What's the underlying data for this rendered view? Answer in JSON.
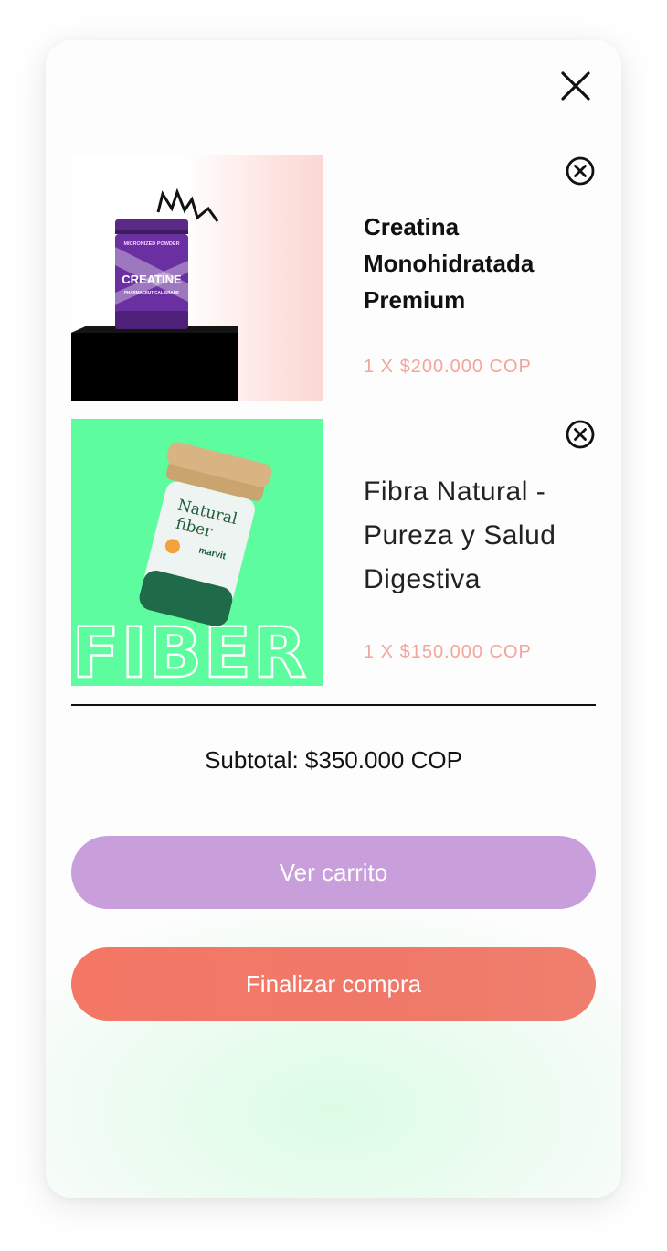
{
  "cart": {
    "close_icon": "close-icon",
    "items": [
      {
        "name": "Creatina Monohidratada Premium",
        "price": "1 X $200.000 COP",
        "remove_icon": "remove-circle-x-icon",
        "image": {
          "canister_top_label": "MICRONIZED POWDER",
          "canister_label": "CREATINE",
          "canister_sub_label": "PHARMACEUTICAL GRADE"
        }
      },
      {
        "name": "Fibra Natural - Pureza y Salud Digestiva",
        "price": "1 X $150.000 COP",
        "remove_icon": "remove-circle-x-icon",
        "image": {
          "jar_label_line1": "Natural",
          "jar_label_line2": "fiber",
          "jar_brand": "marvit",
          "background_word": "FIBER"
        }
      }
    ],
    "subtotal": "Subtotal: $350.000 COP",
    "view_cart_label": "Ver carrito",
    "checkout_label": "Finalizar compra"
  },
  "colors": {
    "price": "#f4a59b",
    "view_cart_button": "#c89fdb",
    "checkout_button": "#f47766",
    "fiber_background": "#5dfd9f"
  }
}
